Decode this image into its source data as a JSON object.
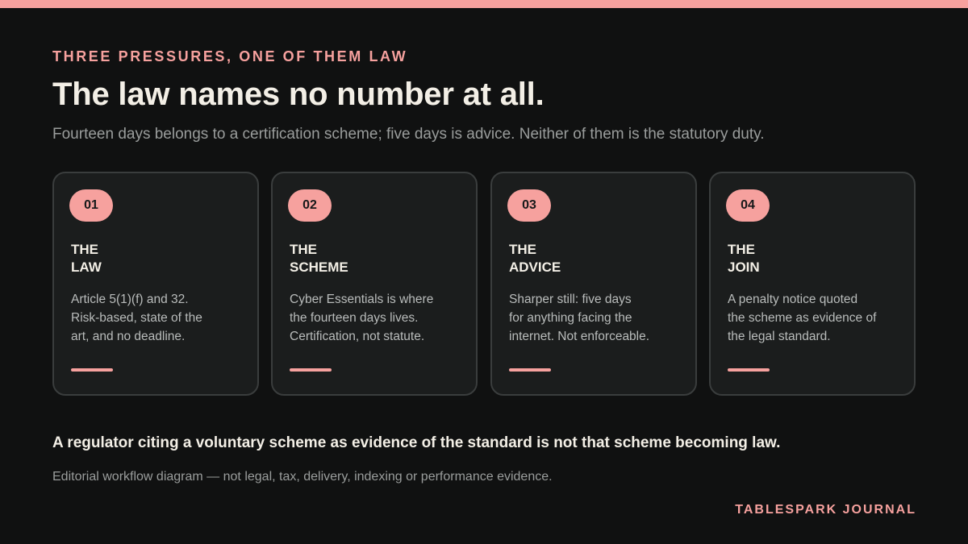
{
  "eyebrow": "THREE PRESSURES, ONE OF THEM LAW",
  "title": "The law names no number at all.",
  "subtitle": "Fourteen days belongs to a certification scheme; five days is advice. Neither of them is the statutory duty.",
  "cards": [
    {
      "number": "01",
      "title_lines": [
        "THE",
        "LAW"
      ],
      "body_lines": [
        "Article 5(1)(f) and 32.",
        "Risk-based, state of the",
        "art, and no deadline."
      ]
    },
    {
      "number": "02",
      "title_lines": [
        "THE",
        "SCHEME"
      ],
      "body_lines": [
        "Cyber Essentials is where",
        "the fourteen days lives.",
        "Certification, not statute."
      ]
    },
    {
      "number": "03",
      "title_lines": [
        "THE",
        "ADVICE"
      ],
      "body_lines": [
        "Sharper still: five days",
        "for anything facing the",
        "internet. Not enforceable."
      ]
    },
    {
      "number": "04",
      "title_lines": [
        "THE",
        "JOIN"
      ],
      "body_lines": [
        "A penalty notice quoted",
        "the scheme as evidence of",
        "the legal standard."
      ]
    }
  ],
  "conclusion": "A regulator citing a voluntary scheme as evidence of the standard is not that scheme becoming law.",
  "disclaimer": "Editorial workflow diagram — not legal, tax, delivery, indexing or performance evidence.",
  "brand": "TABLESPARK JOURNAL",
  "colors": {
    "background": "#101111",
    "accent": "#f6a19e",
    "card_background": "#1b1d1d",
    "card_border": "#3a3d3d",
    "heading_text": "#f3efe6",
    "muted_text": "#9a9d9c"
  }
}
